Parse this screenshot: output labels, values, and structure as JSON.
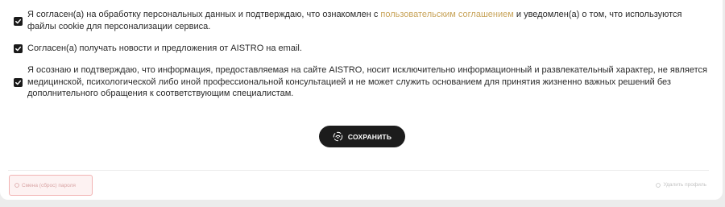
{
  "consents": [
    {
      "checked": true,
      "text_before": "Я согласен(а) на обработку персональных данных и подтверждаю, что ознакомлен с ",
      "link_text": "пользовательским соглашением",
      "text_after": " и уведомлен(а) о том, что используются файлы cookie для персонализации сервиса."
    },
    {
      "checked": true,
      "text": "Согласен(а) получать новости и предложения от AISTRO на email."
    },
    {
      "checked": true,
      "text": "Я осознаю и подтверждаю, что информация, предоставляемая на сайте AISTRO, носит исключительно информационный и развлекательный характер, не является медицинской, психологической либо иной профессиональной консультацией и не может служить основанием для принятия жизненно важных решений без дополнительного обращения к соответствующим специалистам."
    }
  ],
  "save_button": {
    "label": "СОХРАНИТЬ",
    "icon": "save-swirl-icon"
  },
  "footer": {
    "password_button": {
      "label": "Смена (сброс) пароля",
      "icon": "circle-icon"
    },
    "delete_link": {
      "label": "Удалить профиль",
      "icon": "circle-icon"
    }
  },
  "colors": {
    "link": "#c8a45a",
    "button_bg": "#1c1c1c",
    "danger_border": "#f2b3b3"
  }
}
